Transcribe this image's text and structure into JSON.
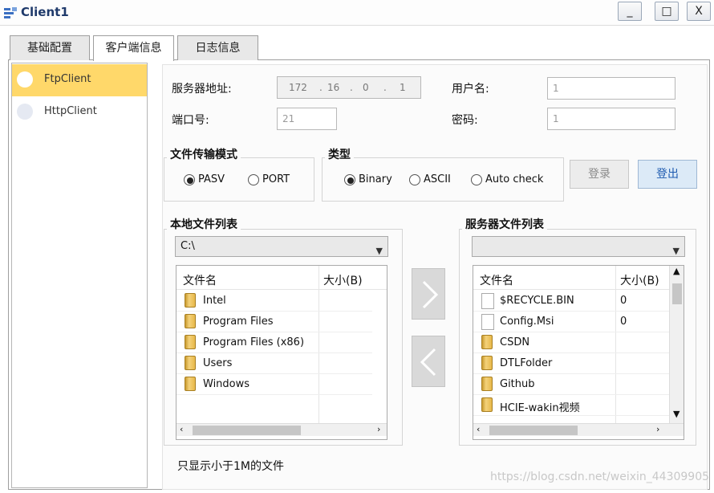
{
  "window": {
    "title": "Client1",
    "minimize": "_",
    "maximize": "□",
    "close": "X"
  },
  "tabs": [
    {
      "label": "基础配置"
    },
    {
      "label": "客户端信息"
    },
    {
      "label": "日志信息"
    }
  ],
  "clients": [
    {
      "label": "FtpClient",
      "selected": true,
      "color": "#ffd86a"
    },
    {
      "label": "HttpClient",
      "selected": false,
      "color": "#e5e9f2"
    }
  ],
  "form": {
    "server_addr_label": "服务器地址:",
    "ip": [
      "172",
      "16",
      "0",
      "1"
    ],
    "port_label": "端口号:",
    "port_value": "21",
    "username_label": "用户名:",
    "username_value": "1",
    "password_label": "密码:",
    "password_value": "1"
  },
  "transfer_mode": {
    "title": "文件传输模式",
    "options": [
      {
        "label": "PASV",
        "selected": true
      },
      {
        "label": "PORT",
        "selected": false
      }
    ]
  },
  "type": {
    "title": "类型",
    "options": [
      {
        "label": "Binary",
        "selected": true
      },
      {
        "label": "ASCII",
        "selected": false
      },
      {
        "label": "Auto check",
        "selected": false
      }
    ]
  },
  "buttons": {
    "login": "登录",
    "logout": "登出"
  },
  "local": {
    "title": "本地文件列表",
    "path": "C:\\",
    "col_name": "文件名",
    "col_size": "大小(B)",
    "files": [
      {
        "name": "Intel",
        "size": ""
      },
      {
        "name": "Program Files",
        "size": ""
      },
      {
        "name": "Program Files (x86)",
        "size": ""
      },
      {
        "name": "Users",
        "size": ""
      },
      {
        "name": "Windows",
        "size": ""
      }
    ]
  },
  "server": {
    "title": "服务器文件列表",
    "path": "",
    "col_name": "文件名",
    "col_size": "大小(B)",
    "files": [
      {
        "name": "$RECYCLE.BIN",
        "size": "0",
        "icon": "file-icon"
      },
      {
        "name": "Config.Msi",
        "size": "0",
        "icon": "file-icon"
      },
      {
        "name": "CSDN",
        "size": "",
        "icon": "folder-icon"
      },
      {
        "name": "DTLFolder",
        "size": "",
        "icon": "folder-icon"
      },
      {
        "name": "Github",
        "size": "",
        "icon": "folder-icon"
      },
      {
        "name": "HCIE-wakin视频",
        "size": "",
        "icon": "folder-icon"
      }
    ]
  },
  "footer_note": "只显示小于1M的文件",
  "watermark": "https://blog.csdn.net/weixin_44309905"
}
